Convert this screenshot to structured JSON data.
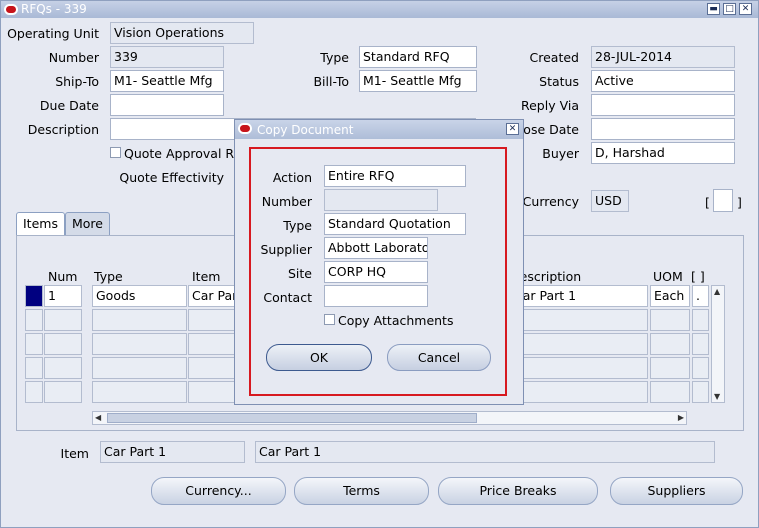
{
  "window": {
    "title": "RFQs - 339"
  },
  "header": {
    "operating_unit_label": "Operating Unit",
    "operating_unit": "Vision Operations",
    "number_label": "Number",
    "number": "339",
    "type_label": "Type",
    "type": "Standard RFQ",
    "created_label": "Created",
    "created": "28-JUL-2014",
    "ship_to_label": "Ship-To",
    "ship_to": "M1- Seattle Mfg",
    "bill_to_label": "Bill-To",
    "bill_to": "M1- Seattle Mfg",
    "status_label": "Status",
    "status": "Active",
    "due_date_label": "Due Date",
    "due_date": "",
    "reply_via_label": "Reply Via",
    "reply_via": "",
    "description_label": "Description",
    "description": "",
    "close_date_label": "Close Date",
    "close_date": "",
    "quote_approval_label": "Quote Approval Rec",
    "buyer_label": "Buyer",
    "buyer": "D, Harshad",
    "quote_effectivity_label": "Quote Effectivity",
    "currency_label": "Currency",
    "currency": "USD"
  },
  "tabs": [
    {
      "label": "Items"
    },
    {
      "label": "More"
    }
  ],
  "grid": {
    "headers": {
      "num": "Num",
      "type": "Type",
      "item": "Item",
      "description": "Description",
      "uom": "UOM",
      "bracket": "[ ]"
    },
    "rows": [
      {
        "num": "1",
        "type": "Goods",
        "item": "Car Part 1",
        "description": "Car Part 1",
        "uom": "Each",
        "dot": "."
      }
    ]
  },
  "footer": {
    "item_label": "Item",
    "item": "Car Part 1",
    "item_description": "Car Part 1"
  },
  "buttons": {
    "currency": "Currency...",
    "terms": "Terms",
    "price_breaks": "Price Breaks",
    "suppliers": "Suppliers"
  },
  "dialog": {
    "title": "Copy Document",
    "action_label": "Action",
    "action": "Entire RFQ",
    "number_label": "Number",
    "number": "",
    "type_label": "Type",
    "type": "Standard Quotation",
    "supplier_label": "Supplier",
    "supplier": "Abbott Laboratorie",
    "site_label": "Site",
    "site": "CORP HQ",
    "contact_label": "Contact",
    "contact": "",
    "copy_attachments_label": "Copy Attachments",
    "ok": "OK",
    "cancel": "Cancel"
  },
  "colors": {
    "title_bar": "#aebdd8",
    "highlight": "#d71920",
    "logo": "#c7141b",
    "selected_row": "#000080"
  }
}
